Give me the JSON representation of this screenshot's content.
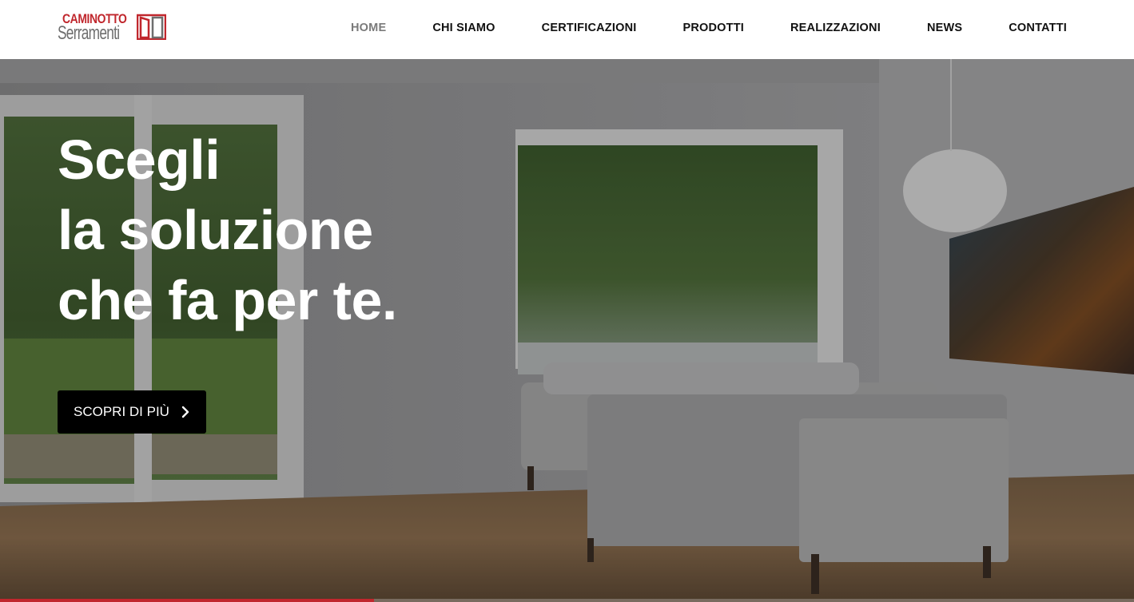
{
  "brand": {
    "name_top": "CAMINOTTO",
    "name_bottom": "Serramenti",
    "accent_color": "#c0272d",
    "logo_icon": "window-frame-icon"
  },
  "nav": {
    "items": [
      {
        "label": "HOME",
        "active": true
      },
      {
        "label": "CHI SIAMO",
        "active": false
      },
      {
        "label": "CERTIFICAZIONI",
        "active": false
      },
      {
        "label": "PRODOTTI",
        "active": false
      },
      {
        "label": "REALIZZAZIONI",
        "active": false
      },
      {
        "label": "NEWS",
        "active": false
      },
      {
        "label": "CONTATTI",
        "active": false
      }
    ]
  },
  "hero": {
    "headline_lines": [
      "Scegli",
      "la soluzione",
      "che fa per te."
    ],
    "cta_label": "SCOPRI DI PIÙ",
    "cta_icon": "chevron-right-icon",
    "slide_progress": 0.33
  }
}
